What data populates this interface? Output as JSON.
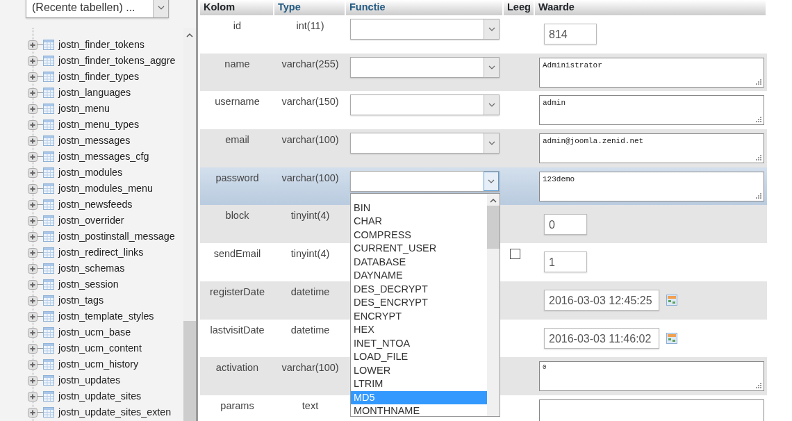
{
  "sidebar": {
    "recent_tables": {
      "value": "(Recente tabellen) ..."
    },
    "tables": [
      {
        "name": "jostn_finder_tokens"
      },
      {
        "name": "jostn_finder_tokens_aggre"
      },
      {
        "name": "jostn_finder_types"
      },
      {
        "name": "jostn_languages"
      },
      {
        "name": "jostn_menu"
      },
      {
        "name": "jostn_menu_types"
      },
      {
        "name": "jostn_messages"
      },
      {
        "name": "jostn_messages_cfg"
      },
      {
        "name": "jostn_modules"
      },
      {
        "name": "jostn_modules_menu"
      },
      {
        "name": "jostn_newsfeeds"
      },
      {
        "name": "jostn_overrider"
      },
      {
        "name": "jostn_postinstall_message"
      },
      {
        "name": "jostn_redirect_links"
      },
      {
        "name": "jostn_schemas"
      },
      {
        "name": "jostn_session"
      },
      {
        "name": "jostn_tags"
      },
      {
        "name": "jostn_template_styles"
      },
      {
        "name": "jostn_ucm_base"
      },
      {
        "name": "jostn_ucm_content"
      },
      {
        "name": "jostn_ucm_history"
      },
      {
        "name": "jostn_updates"
      },
      {
        "name": "jostn_update_sites"
      },
      {
        "name": "jostn_update_sites_exten"
      }
    ]
  },
  "table": {
    "columns": [
      {
        "label": "Kolom",
        "kind": "plain"
      },
      {
        "label": "Type",
        "kind": "link"
      },
      {
        "label": "Functie",
        "kind": "link"
      },
      {
        "label": "Leeg",
        "kind": "plain"
      },
      {
        "label": "Waarde",
        "kind": "plain"
      }
    ],
    "rows": [
      {
        "column": "id",
        "type": "int(11)",
        "highlighted": false,
        "function_select": {
          "open": false
        },
        "value": {
          "kind": "input",
          "text": "814"
        }
      },
      {
        "column": "name",
        "type": "varchar(255)",
        "highlighted": false,
        "function_select": {
          "open": false
        },
        "value": {
          "kind": "textarea",
          "text": "Administrator"
        }
      },
      {
        "column": "username",
        "type": "varchar(150)",
        "highlighted": false,
        "function_select": {
          "open": false
        },
        "value": {
          "kind": "textarea",
          "text": "admin"
        }
      },
      {
        "column": "email",
        "type": "varchar(100)",
        "highlighted": false,
        "function_select": {
          "open": false
        },
        "value": {
          "kind": "textarea",
          "text": "admin@joomla.zenid.net"
        }
      },
      {
        "column": "password",
        "type": "varchar(100)",
        "highlighted": true,
        "function_select": {
          "open": true
        },
        "value": {
          "kind": "textarea",
          "text": "123demo"
        }
      },
      {
        "column": "block",
        "type": "tinyint(4)",
        "highlighted": false,
        "value": {
          "kind": "input",
          "text": "0"
        }
      },
      {
        "column": "sendEmail",
        "type": "tinyint(4)",
        "highlighted": false,
        "null_checkbox": {
          "checked": false
        },
        "value": {
          "kind": "input",
          "text": "1"
        }
      },
      {
        "column": "registerDate",
        "type": "datetime",
        "highlighted": false,
        "value": {
          "kind": "datetime",
          "text": "2016-03-03 12:45:25"
        }
      },
      {
        "column": "lastvisitDate",
        "type": "datetime",
        "highlighted": false,
        "value": {
          "kind": "datetime",
          "text": "2016-03-03 11:46:02"
        }
      },
      {
        "column": "activation",
        "type": "varchar(100)",
        "highlighted": false,
        "value": {
          "kind": "textarea",
          "text": "0"
        }
      },
      {
        "column": "params",
        "type": "text",
        "highlighted": false,
        "value": {
          "kind": "textarea"
        }
      }
    ],
    "function_dropdown": {
      "options": [
        {
          "label": "BIN",
          "selected": false
        },
        {
          "label": "CHAR",
          "selected": false
        },
        {
          "label": "COMPRESS",
          "selected": false
        },
        {
          "label": "CURRENT_USER",
          "selected": false
        },
        {
          "label": "DATABASE",
          "selected": false
        },
        {
          "label": "DAYNAME",
          "selected": false
        },
        {
          "label": "DES_DECRYPT",
          "selected": false
        },
        {
          "label": "DES_ENCRYPT",
          "selected": false
        },
        {
          "label": "ENCRYPT",
          "selected": false
        },
        {
          "label": "HEX",
          "selected": false
        },
        {
          "label": "INET_NTOA",
          "selected": false
        },
        {
          "label": "LOAD_FILE",
          "selected": false
        },
        {
          "label": "LOWER",
          "selected": false
        },
        {
          "label": "LTRIM",
          "selected": false
        },
        {
          "label": "MD5",
          "selected": true
        },
        {
          "label": "MONTHNAME",
          "selected": false
        }
      ]
    }
  }
}
